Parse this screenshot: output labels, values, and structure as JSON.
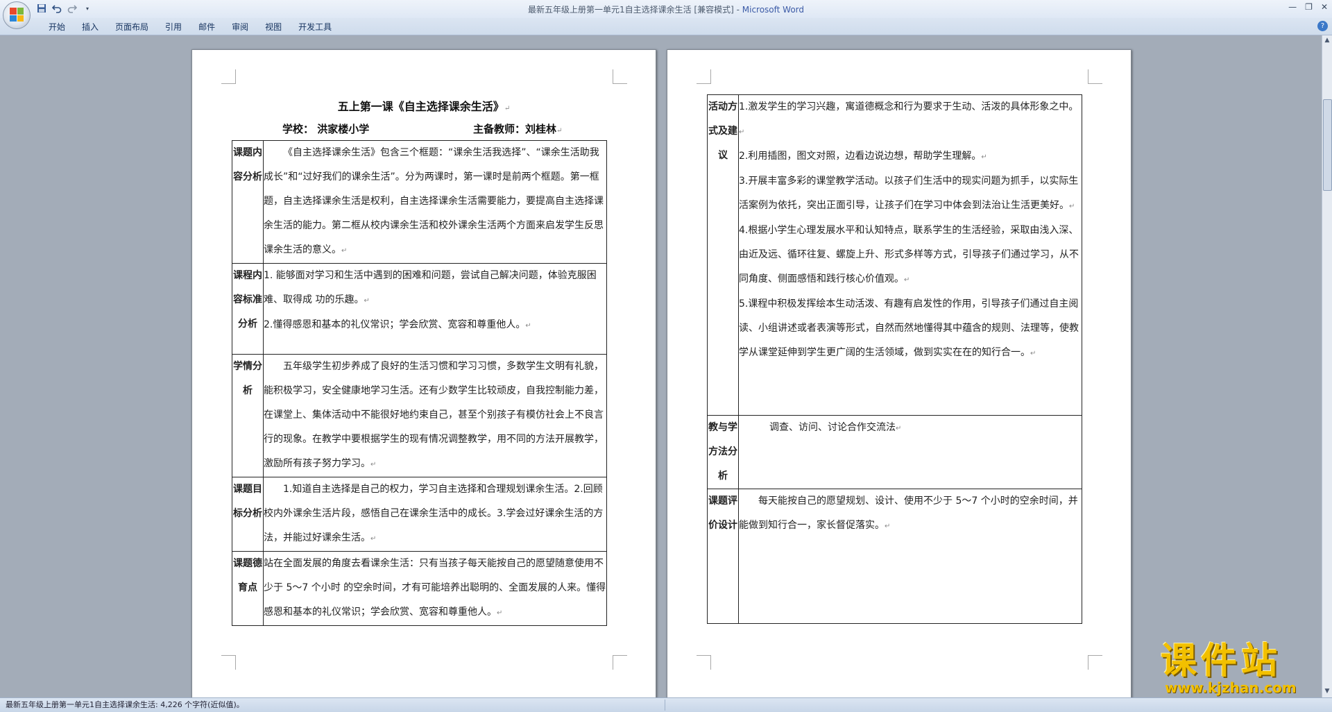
{
  "window": {
    "title": "最新五年级上册第一单元1自主选择课余生活 [兼容模式]",
    "title_sep": " - ",
    "app_name": "Microsoft Word"
  },
  "ribbon": {
    "tabs": [
      "开始",
      "插入",
      "页面布局",
      "引用",
      "邮件",
      "审阅",
      "视图",
      "开发工具"
    ]
  },
  "page1": {
    "title": "五上第一课《自主选择课余生活》",
    "school_label": "学校：  洪家楼小学",
    "teacher_label": "主备教师：刘桂林",
    "rows": [
      {
        "label": "课题内容分析",
        "text": "《自主选择课余生活》包含三个框题：“课余生活我选择”、“课余生活助我成长”和“过好我们的课余生活”。分为两课时，第一课时是前两个框题。第一框题，自主选择课余生活是权利，自主选择课余生活需要能力，要提高自主选择课余生活的能力。第二框从校内课余生活和校外课余生活两个方面来启发学生反思课余生活的意义。"
      },
      {
        "label": "课程内容标准分析",
        "text1": "1. 能够面对学习和生活中遇到的困难和问题，尝试自己解决问题，体验克服困难、取得成 功的乐趣。",
        "text2": "2.懂得感恩和基本的礼仪常识；学会欣赏、宽容和尊重他人。"
      },
      {
        "label": "学情分析",
        "text": "五年级学生初步养成了良好的生活习惯和学习习惯，多数学生文明有礼貌，能积极学习，安全健康地学习生活。还有少数学生比较顽皮，自我控制能力差，在课堂上、集体活动中不能很好地约束自己，甚至个别孩子有模仿社会上不良言行的现象。在教学中要根据学生的现有情况调整教学，用不同的方法开展教学，激励所有孩子努力学习。"
      },
      {
        "label": "课题目标分析",
        "text": "1.知道自主选择是自己的权力，学习自主选择和合理规划课余生活。2.回顾校内外课余生活片段，感悟自己在课余生活中的成长。3.学会过好课余生活的方法，并能过好课余生活。"
      },
      {
        "label": "课题德育点",
        "text": "站在全面发展的角度去看课余生活：只有当孩子每天能按自己的愿望随意使用不少于 5～7 个小时  的空余时间，才有可能培养出聪明的、全面发展的人来。懂得感恩和基本的礼仪常识；学会欣赏、宽容和尊重他人。"
      }
    ]
  },
  "page2": {
    "rows": [
      {
        "label": "活动方式及建议",
        "items": [
          "1.激发学生的学习兴趣，寓道德概念和行为要求于生动、活泼的具体形象之中。",
          "2.利用插图，图文对照，边看边说边想，帮助学生理解。",
          "3.开展丰富多彩的课堂教学活动。以孩子们生活中的现实问题为抓手，以实际生活案例为依托，突出正面引导，让孩子们在学习中体会到法治让生活更美好。",
          "4.根据小学生心理发展水平和认知特点，联系学生的生活经验，采取由浅入深、由近及远、循环往复、螺旋上升、形式多样等方式，引导孩子们通过学习，从不同角度、侧面感悟和践行核心价值观。",
          "5.课程中积极发挥绘本生动活泼、有趣有启发性的作用，引导孩子们通过自主阅读、小组讲述或者表演等形式，自然而然地懂得其中蕴含的规则、法理等，使教学从课堂延伸到学生更广阔的生活领域，做到实实在在的知行合一。"
        ]
      },
      {
        "label": "教与学方法分析",
        "text": "调查、访问、讨论合作交流法"
      },
      {
        "label": "课题评价设计",
        "text": "每天能按自己的愿望规划、设计、使用不少于 5～7 个小时的空余时间，并能做到知行合一，家长督促落实。"
      }
    ]
  },
  "status": {
    "text": "最新五年级上册第一单元1自主选择课余生活: 4,226 个字符(近似值)。"
  },
  "watermark": {
    "name": "课件站",
    "url": "www.kjzhan.com"
  },
  "icons": {
    "office_button": "office-logo-icon",
    "save": "save-icon",
    "undo": "undo-icon",
    "redo": "redo-icon",
    "help": "help-icon"
  },
  "colors": {
    "app_name": "#3b5aa6",
    "watermark": "#f2c000"
  }
}
